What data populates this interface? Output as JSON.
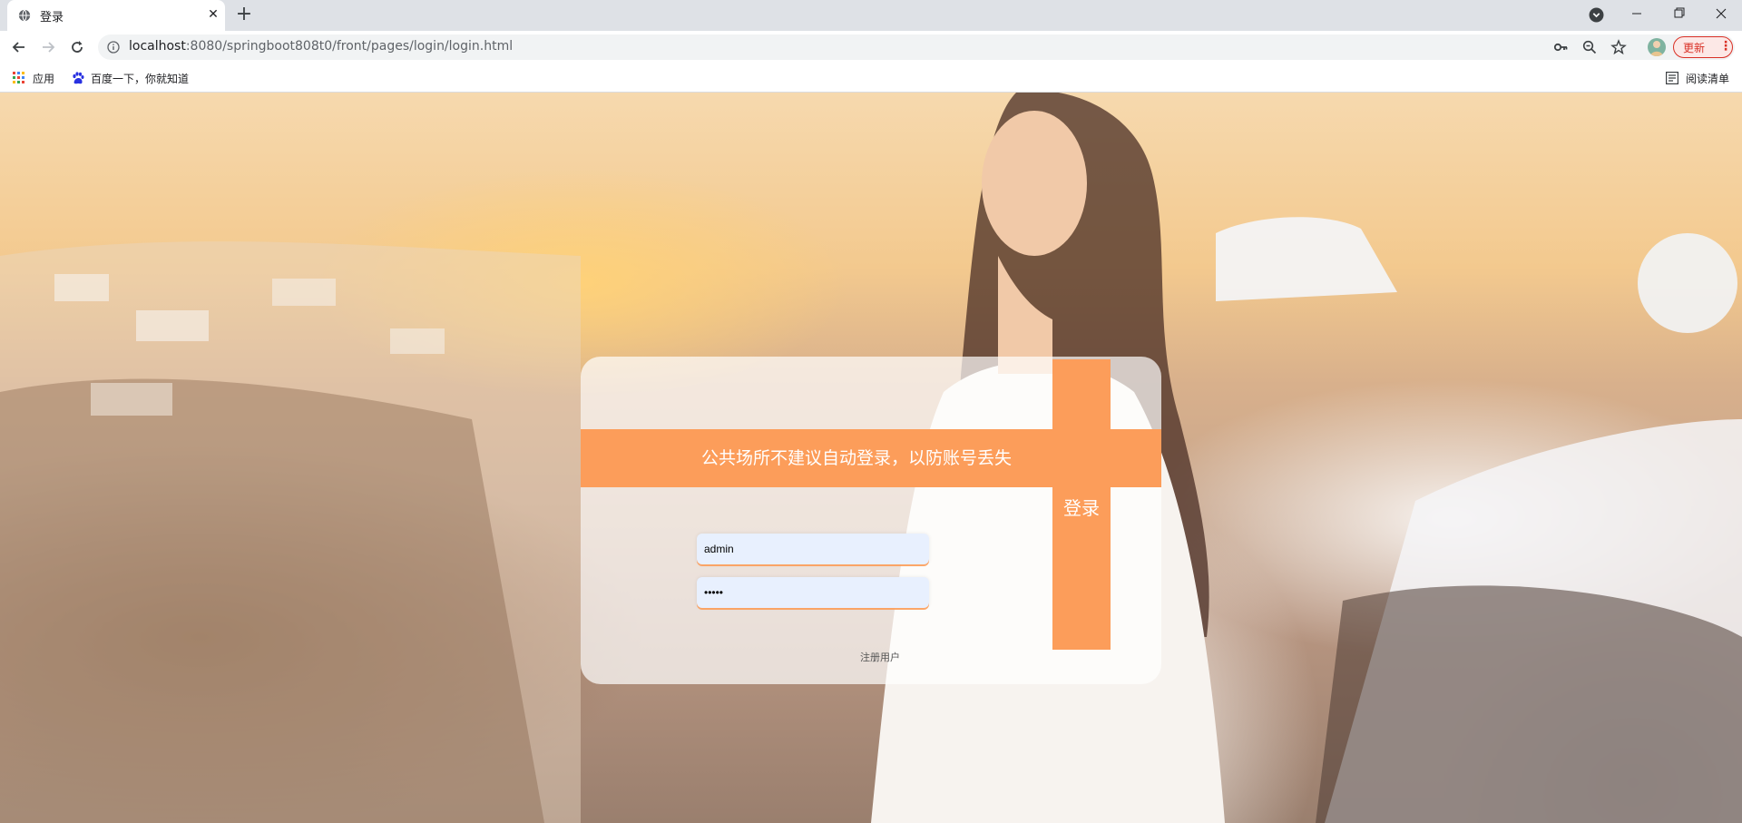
{
  "browser": {
    "tab_title": "登录",
    "url_host": "localhost",
    "url_rest": ":8080/springboot808t0/front/pages/login/login.html",
    "update_label": "更新",
    "bookmarks": [
      {
        "label": "应用"
      },
      {
        "label": "百度一下，你就知道"
      }
    ],
    "reading_list_label": "阅读清单"
  },
  "login": {
    "notice": "公共场所不建议自动登录，以防账号丢失",
    "submit_label": "登录",
    "username_value": "admin",
    "password_value": "admin",
    "register_label": "注册用户"
  },
  "colors": {
    "accent": "#fc9d5a",
    "card": "rgba(255,255,255,0.70)",
    "input_bg": "#e8f0fe"
  }
}
